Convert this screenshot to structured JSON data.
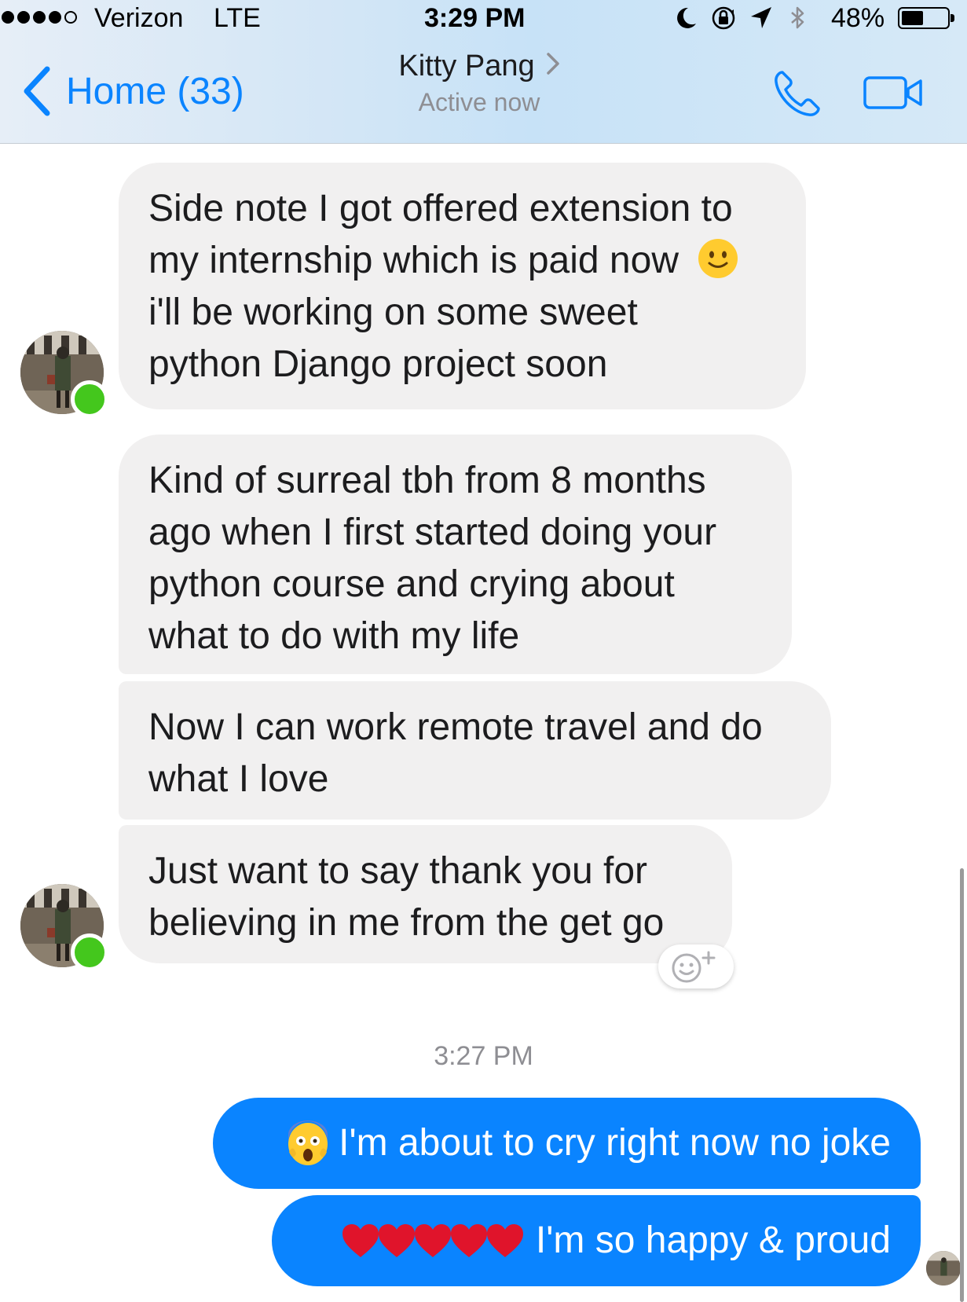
{
  "status_bar": {
    "signal_bars_filled": 4,
    "signal_bars_total": 5,
    "carrier": "Verizon",
    "network": "LTE",
    "time": "3:29 PM",
    "battery_percent_label": "48%",
    "battery_level": 0.48,
    "icons": [
      "moon-icon",
      "rotation-lock-icon",
      "location-arrow-icon",
      "bluetooth-icon",
      "battery-icon"
    ]
  },
  "nav": {
    "back_label": "Home (33)",
    "contact_name": "Kitty Pang",
    "contact_status": "Active now",
    "call_icon": "phone-icon",
    "video_icon": "video-camera-icon"
  },
  "messages": {
    "incoming": [
      {
        "lines": [
          "Side note I got offered extension to",
          "my internship which is paid now",
          "i'll be working on some sweet",
          "python Django project soon"
        ],
        "emoji": "slightly-smiling-face"
      },
      {
        "lines": [
          "Kind of surreal tbh from 8 months",
          "ago when I first started doing your",
          "python course and crying about",
          "what to do with my life"
        ]
      },
      {
        "lines": [
          "Now I can work remote travel and do",
          "what I love"
        ]
      },
      {
        "lines": [
          "Just want to say thank you for",
          "believing in me from the get go"
        ]
      }
    ],
    "timestamp": "3:27 PM",
    "outgoing": [
      {
        "text": "I'm about to cry right now no joke",
        "emoji": "face-screaming-in-fear"
      },
      {
        "text": "I'm so happy & proud",
        "emoji": "red-heart",
        "emoji_count": 5
      }
    ]
  },
  "colors": {
    "accent_blue": "#0a84ff",
    "incoming_bubble": "#f1f0f0",
    "presence_green": "#44c71d",
    "secondary_text": "#8e8e93"
  }
}
